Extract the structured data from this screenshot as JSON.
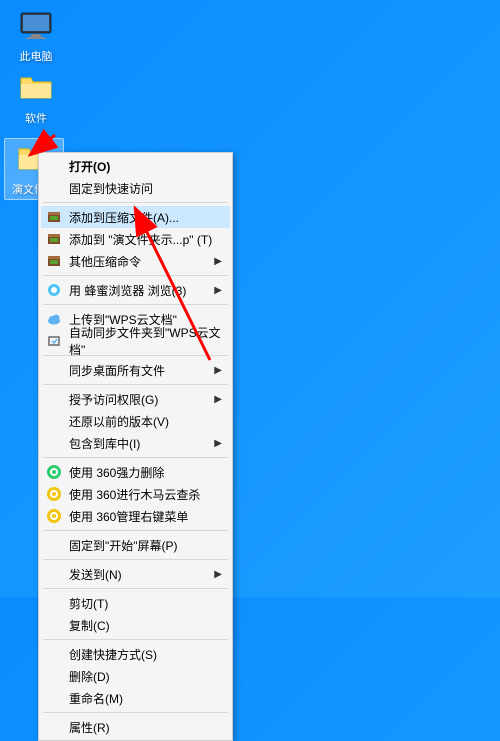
{
  "desktop": {
    "icons": [
      {
        "label": "此电脑",
        "type": "computer"
      },
      {
        "label": "软件",
        "type": "folder-yellow"
      },
      {
        "label": "演文件夹",
        "type": "folder-yellow"
      }
    ]
  },
  "context_menu": {
    "items": [
      {
        "label": "打开(O)",
        "bold": true
      },
      {
        "label": "固定到快速访问"
      },
      {
        "separator": true
      },
      {
        "label": "添加到压缩文件(A)...",
        "icon": "winrar",
        "highlighted": true
      },
      {
        "label": "添加到 \"演文件夹示...p\" (T)",
        "icon": "winrar"
      },
      {
        "label": "其他压缩命令",
        "icon": "winrar",
        "submenu": true
      },
      {
        "separator": true
      },
      {
        "label": "用 蜂蜜浏览器 浏览(3)",
        "icon": "browser",
        "submenu": true
      },
      {
        "separator": true
      },
      {
        "label": "上传到\"WPS云文档\"",
        "icon": "cloud"
      },
      {
        "label": "自动同步文件夹到\"WPS云文档\"",
        "icon": "sync"
      },
      {
        "separator": true
      },
      {
        "label": "同步桌面所有文件",
        "submenu": true
      },
      {
        "separator": true
      },
      {
        "label": "授予访问权限(G)",
        "submenu": true
      },
      {
        "label": "还原以前的版本(V)"
      },
      {
        "label": "包含到库中(I)",
        "submenu": true
      },
      {
        "separator": true
      },
      {
        "label": "使用 360强力删除",
        "icon": "360"
      },
      {
        "label": "使用 360进行木马云查杀",
        "icon": "360y"
      },
      {
        "label": "使用 360管理右键菜单",
        "icon": "360y"
      },
      {
        "separator": true
      },
      {
        "label": "固定到\"开始\"屏幕(P)"
      },
      {
        "separator": true
      },
      {
        "label": "发送到(N)",
        "submenu": true
      },
      {
        "separator": true
      },
      {
        "label": "剪切(T)"
      },
      {
        "label": "复制(C)"
      },
      {
        "separator": true
      },
      {
        "label": "创建快捷方式(S)"
      },
      {
        "label": "删除(D)"
      },
      {
        "label": "重命名(M)"
      },
      {
        "separator": true
      },
      {
        "label": "属性(R)"
      }
    ]
  },
  "annotation": {
    "color": "#ff0000"
  }
}
